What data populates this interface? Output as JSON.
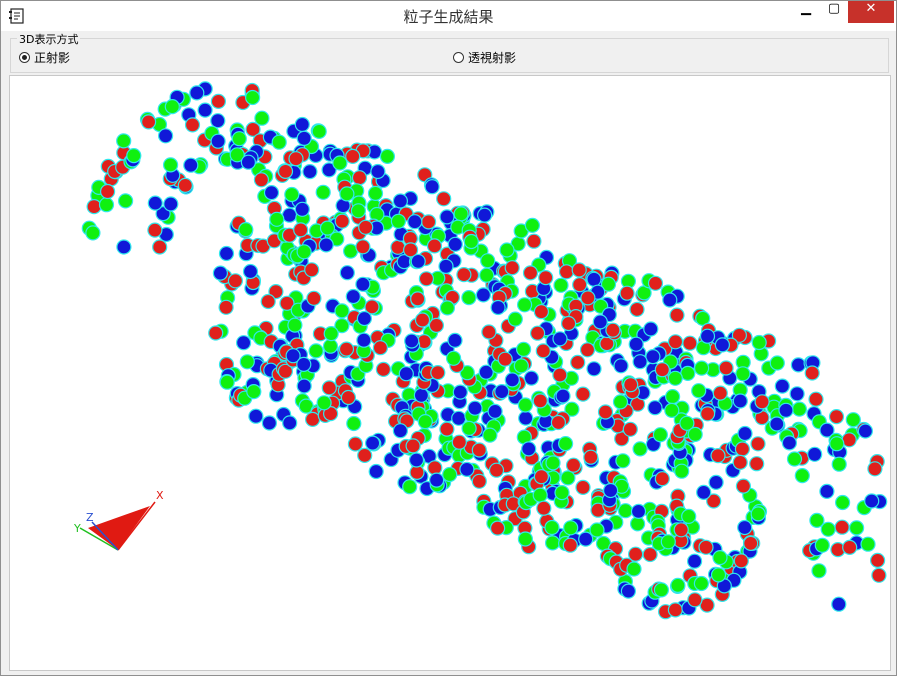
{
  "window": {
    "title": "粒子生成結果"
  },
  "controls": {
    "minimize": "▁",
    "maximize": "▢",
    "close": "✕"
  },
  "projection": {
    "group_label": "3D表示方式",
    "options": [
      {
        "label": "正射影",
        "selected": true
      },
      {
        "label": "透視射影",
        "selected": false
      }
    ]
  },
  "axes": {
    "x": "X",
    "y": "Y",
    "z": "Z"
  },
  "colors": {
    "particle_red": "#e0201c",
    "particle_green": "#10f010",
    "particle_blue": "#1018d8",
    "mesh": "#30e8ec"
  }
}
